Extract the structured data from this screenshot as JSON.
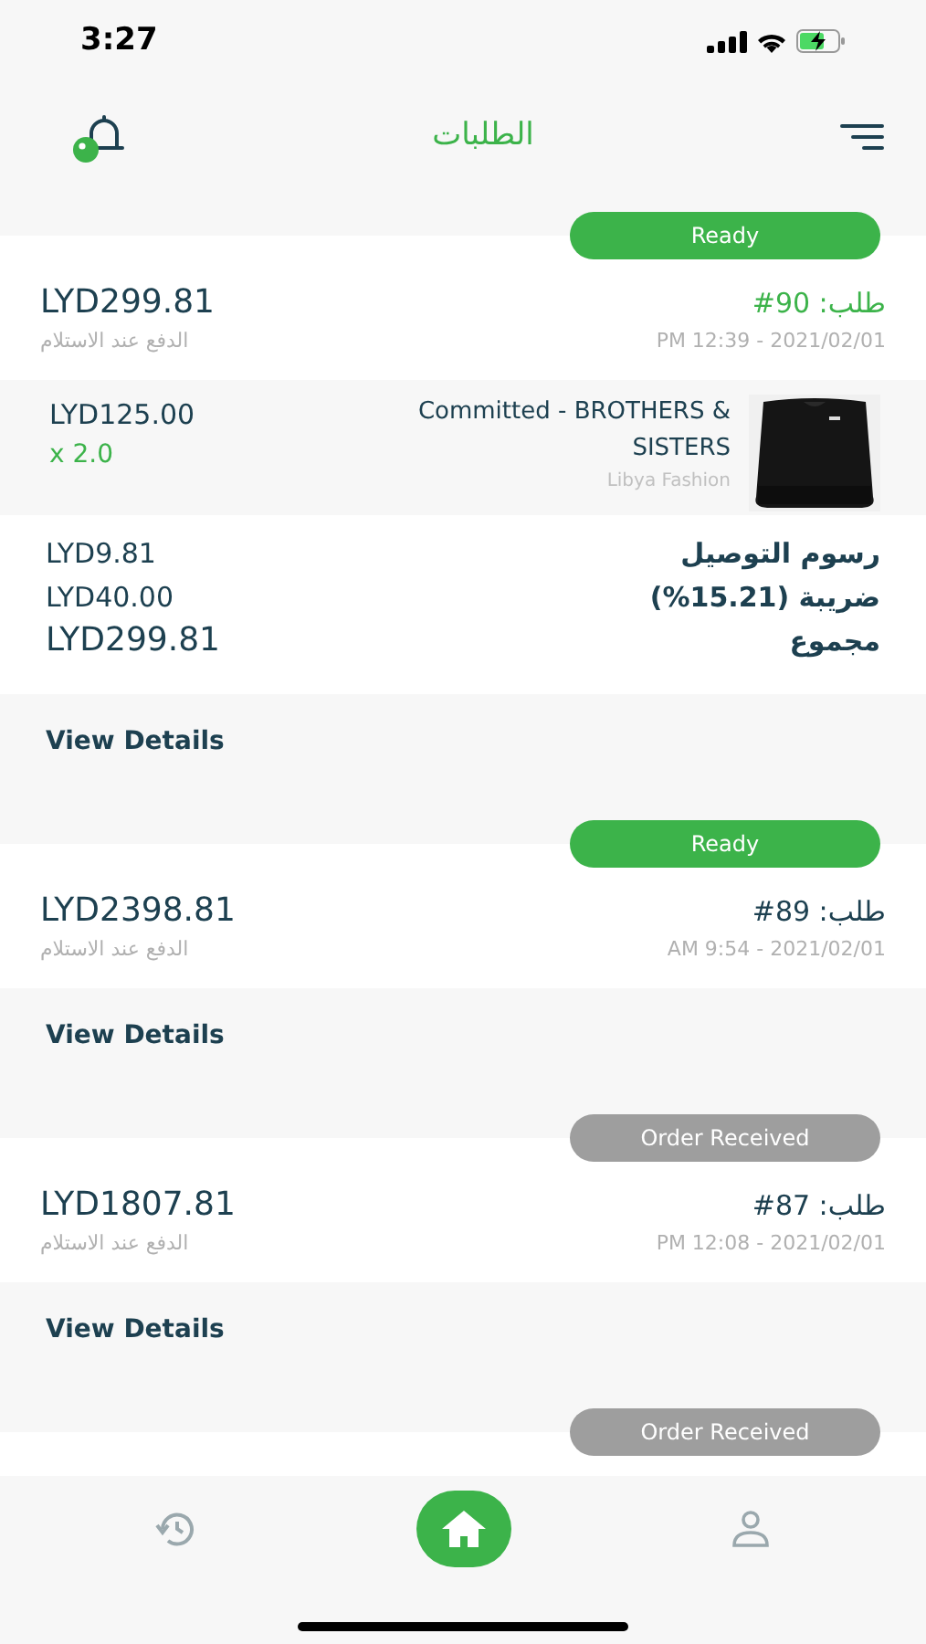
{
  "status_bar": {
    "time": "3:27"
  },
  "header": {
    "title": "الطلبات"
  },
  "orders": [
    {
      "status": "Ready",
      "kind": "ready",
      "total": "LYD299.81",
      "payment": "الدفع عند الاستلام",
      "number": "طلب: 90#",
      "selected": true,
      "date": "PM 12:39 - 2021/02/01",
      "items": [
        {
          "kind": "picture",
          "price": "LYD125.00",
          "quantity": "x 2.0",
          "name": "Committed - BROTHERS & SISTERS",
          "store": "Libya Fashion"
        }
      ],
      "summary": [
        {
          "label": "رسوم التوصيل",
          "value": "LYD9.81"
        },
        {
          "label": "ضريبة (15.21%)",
          "value": "LYD40.00"
        },
        {
          "label": "مجموع",
          "value": "LYD299.81"
        }
      ],
      "link": "View Details"
    },
    {
      "status": "Ready",
      "kind": "ready",
      "total": "LYD2398.81",
      "payment": "الدفع عند الاستلام",
      "number": "طلب: 89#",
      "selected": false,
      "date": "AM 9:54 - 2021/02/01",
      "link": "View Details"
    },
    {
      "status": "Order Received",
      "kind": "received",
      "total": "LYD1807.81",
      "payment": "الدفع عند الاستلام",
      "number": "طلب: 87#",
      "selected": false,
      "date": "PM 12:08 - 2021/02/01",
      "link": "View Details"
    },
    {
      "status": "Order Received",
      "kind": "received"
    }
  ],
  "bottom_nav": [
    {
      "kind": "history",
      "selected": false
    },
    {
      "kind": "home",
      "selected": true
    },
    {
      "kind": "profile",
      "selected": false
    }
  ]
}
